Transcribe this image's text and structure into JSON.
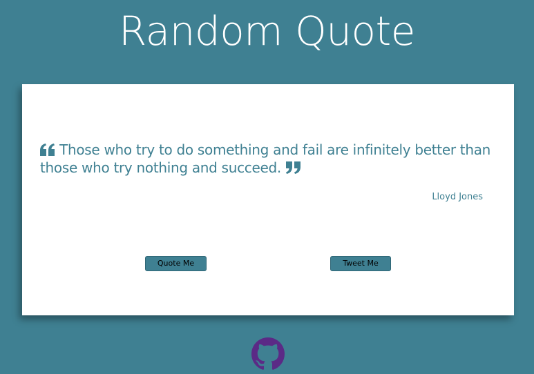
{
  "page": {
    "title": "Random Quote"
  },
  "quote": {
    "text": "Those who try to do something and fail are infinitely better than those who try nothing and succeed.",
    "author": "Lloyd Jones"
  },
  "buttons": {
    "quote_label": "Quote Me",
    "tweet_label": "Tweet Me"
  },
  "icons": {
    "open_quote": "quote-left-icon",
    "close_quote": "quote-right-icon",
    "footer": "github-icon"
  },
  "colors": {
    "background": "#3f8092",
    "card": "#ffffff",
    "accent": "#3f8092",
    "github": "#5b2a86"
  }
}
